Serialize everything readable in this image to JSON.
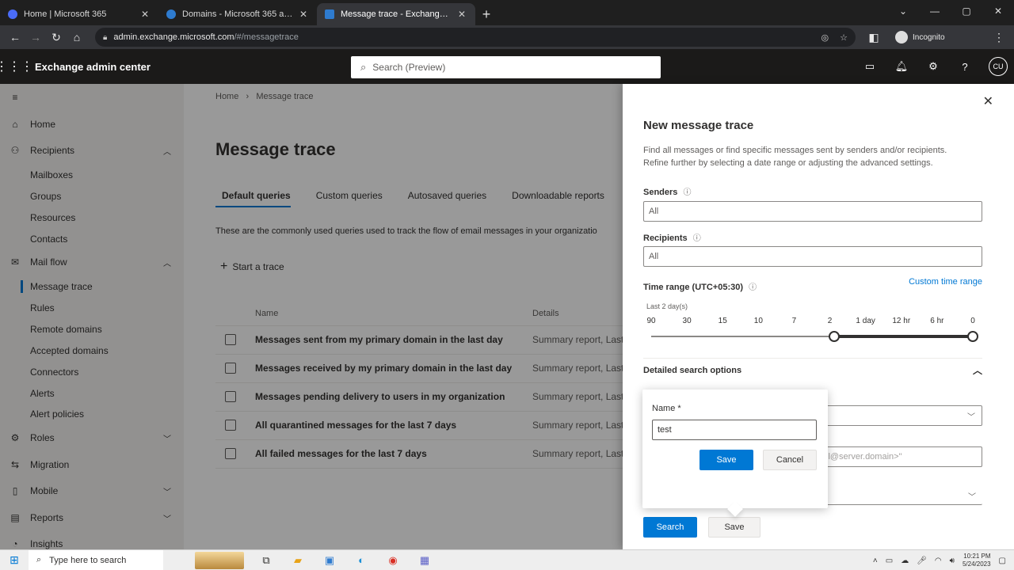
{
  "browser": {
    "tabs": [
      {
        "title": "Home | Microsoft 365",
        "color": "#4a6cf7"
      },
      {
        "title": "Domains - Microsoft 365 admin",
        "color": "#2e7bcf"
      },
      {
        "title": "Message trace - Exchange admi",
        "color": "#2e7bcf"
      }
    ],
    "active_tab": 2,
    "url_host": "admin.exchange.microsoft.com",
    "url_path": "/#/messagetrace",
    "profile_label": "Incognito"
  },
  "app": {
    "title": "Exchange admin center",
    "search_placeholder": "Search (Preview)",
    "avatar_initials": "CU"
  },
  "nav": {
    "items": [
      {
        "label": "Home",
        "icon": "home-icon",
        "glyph": "⌂"
      },
      {
        "label": "Recipients",
        "icon": "person-icon",
        "glyph": "⚇",
        "chevron": "up"
      },
      {
        "label": "Mail flow",
        "icon": "mail-icon",
        "glyph": "✉",
        "chevron": "up"
      },
      {
        "label": "Roles",
        "icon": "roles-icon",
        "glyph": "⚙",
        "chevron": "down"
      },
      {
        "label": "Migration",
        "icon": "migration-icon",
        "glyph": "⇆"
      },
      {
        "label": "Mobile",
        "icon": "mobile-icon",
        "glyph": "▯",
        "chevron": "down"
      },
      {
        "label": "Reports",
        "icon": "reports-icon",
        "glyph": "▤",
        "chevron": "down"
      },
      {
        "label": "Insights",
        "icon": "insights-icon",
        "glyph": "◔"
      }
    ],
    "recipients_sub": [
      "Mailboxes",
      "Groups",
      "Resources",
      "Contacts"
    ],
    "mailflow_sub": [
      "Message trace",
      "Rules",
      "Remote domains",
      "Accepted domains",
      "Connectors",
      "Alerts",
      "Alert policies"
    ]
  },
  "main": {
    "breadcrumb": [
      "Home",
      "Message trace"
    ],
    "title": "Message trace",
    "tabs": [
      "Default queries",
      "Custom queries",
      "Autosaved queries",
      "Downloadable reports"
    ],
    "description": "These are the commonly used queries used to track the flow of email messages in your organizatio",
    "start_trace": "Start a trace",
    "columns": {
      "name": "Name",
      "details": "Details"
    },
    "rows": [
      {
        "name": "Messages sent from my primary domain in the last day",
        "details": "Summary report, Last"
      },
      {
        "name": "Messages received by my primary domain in the last day",
        "details": "Summary report, Last"
      },
      {
        "name": "Messages pending delivery to users in my organization",
        "details": "Summary report, Last"
      },
      {
        "name": "All quarantined messages for the last 7 days",
        "details": "Summary report, Last"
      },
      {
        "name": "All failed messages for the last 7 days",
        "details": "Summary report, Last"
      }
    ]
  },
  "panel": {
    "title": "New message trace",
    "description": "Find all messages or find specific messages sent by senders and/or recipients. Refine further by selecting a date range or adjusting the advanced settings.",
    "senders_label": "Senders",
    "senders_value": "All",
    "recipients_label": "Recipients",
    "recipients_value": "All",
    "time_range_label": "Time range (UTC+05:30)",
    "custom_range": "Custom time range",
    "slider_label": "Last 2 day(s)",
    "slider_ticks": [
      "90",
      "30",
      "15",
      "10",
      "7",
      "2",
      "1 day",
      "12 hr",
      "6 hr",
      "0"
    ],
    "slider_value_fraction": 0.57,
    "detailed_label": "Detailed search options",
    "field_placeholder": "ll@server.domain>\"",
    "search_button": "Search",
    "save_button": "Save"
  },
  "callout": {
    "name_label": "Name *",
    "name_value": "test",
    "save_button": "Save",
    "cancel_button": "Cancel"
  },
  "taskbar": {
    "search_placeholder": "Type here to search",
    "time": "10:21 PM",
    "date": "5/24/2023"
  }
}
